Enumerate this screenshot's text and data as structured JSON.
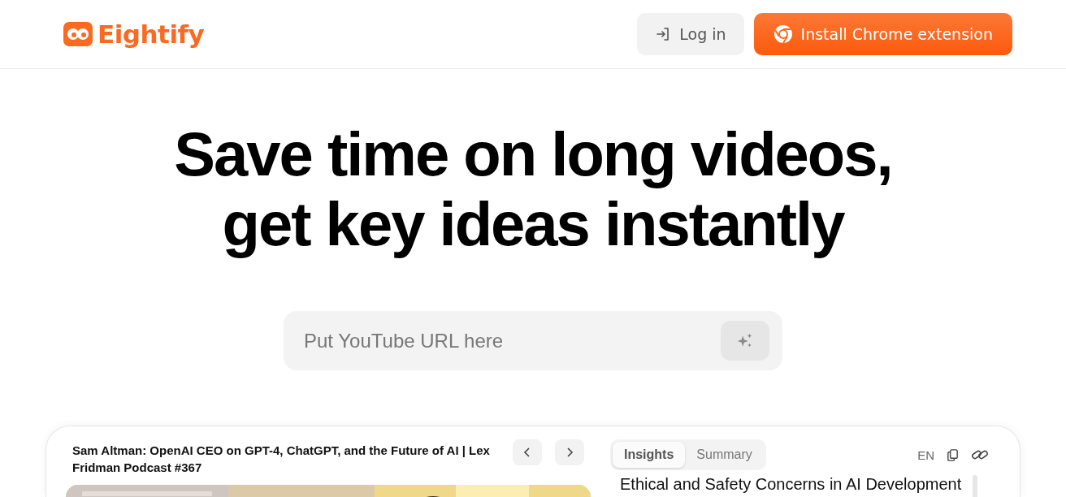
{
  "header": {
    "logo": "Eightify",
    "login": "Log in",
    "install": "Install Chrome extension"
  },
  "headline": [
    "Save time on long videos,",
    "get key ideas instantly"
  ],
  "search": {
    "placeholder": "Put YouTube URL here"
  },
  "demo": {
    "video_title": "Sam Altman: OpenAI CEO on GPT-4, ChatGPT, and the Future of AI | Lex Fridman Podcast #367",
    "tabs": [
      {
        "label": "Insights",
        "selected": true
      },
      {
        "label": "Summary",
        "selected": false
      }
    ],
    "language": "EN",
    "heading": "Ethical and Safety Concerns in AI Development"
  }
}
